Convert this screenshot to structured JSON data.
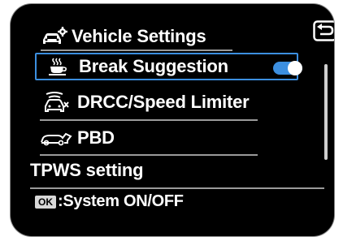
{
  "header": {
    "title": "Vehicle Settings",
    "title_icon": "car-settings-icon",
    "back_icon": "back-arrow-icon"
  },
  "menu": {
    "items": [
      {
        "label": "Break Suggestion",
        "icon": "coffee-cup-icon",
        "selected": true,
        "toggle_on": true
      },
      {
        "label": "DRCC/Speed Limiter",
        "icon": "radar-cruise-icon"
      },
      {
        "label": "PBD",
        "icon": "power-back-door-icon"
      },
      {
        "label": "TPWS setting",
        "icon": ""
      }
    ]
  },
  "footer": {
    "ok_badge": "OK",
    "text": ":System ON/OFF"
  },
  "colors": {
    "background": "#000000",
    "highlight": "#3c8fe0",
    "divider": "#9a9a9a",
    "text": "#ffffff"
  }
}
